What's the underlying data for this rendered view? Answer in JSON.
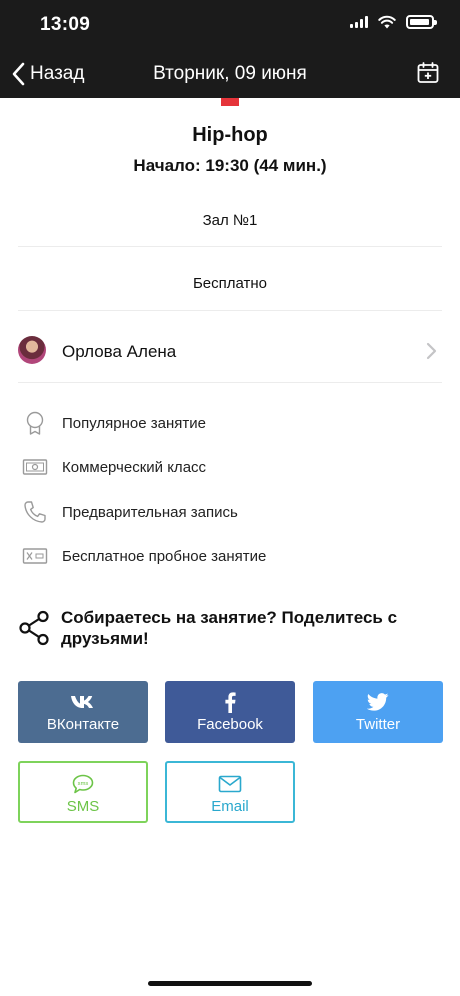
{
  "status_bar": {
    "time": "13:09"
  },
  "nav": {
    "back_label": "Назад",
    "title": "Вторник, 09 июня"
  },
  "class": {
    "title": "Hip-hop",
    "start": "Начало: 19:30 (44 мин.)",
    "hall": "Зал №1",
    "price": "Бесплатно",
    "color": "#e5343a"
  },
  "trainer": {
    "name": "Орлова Алена"
  },
  "features": [
    {
      "icon": "award-icon",
      "label": "Популярное занятие"
    },
    {
      "icon": "banknote-icon",
      "label": "Коммерческий класс"
    },
    {
      "icon": "phone-icon",
      "label": "Предварительная запись"
    },
    {
      "icon": "ticket-icon",
      "label": "Бесплатное пробное занятие"
    }
  ],
  "share": {
    "text": "Собираетесь на занятие? Поделитесь с друзьями!",
    "vk_label": "ВКонтакте",
    "facebook_label": "Facebook",
    "twitter_label": "Twitter",
    "sms_label": "SMS",
    "email_label": "Email",
    "colors": {
      "vk": "#4c6c91",
      "facebook": "#3f5a98",
      "twitter": "#4da1f2",
      "sms": "#7ed35b",
      "email": "#3bb7d6"
    }
  }
}
